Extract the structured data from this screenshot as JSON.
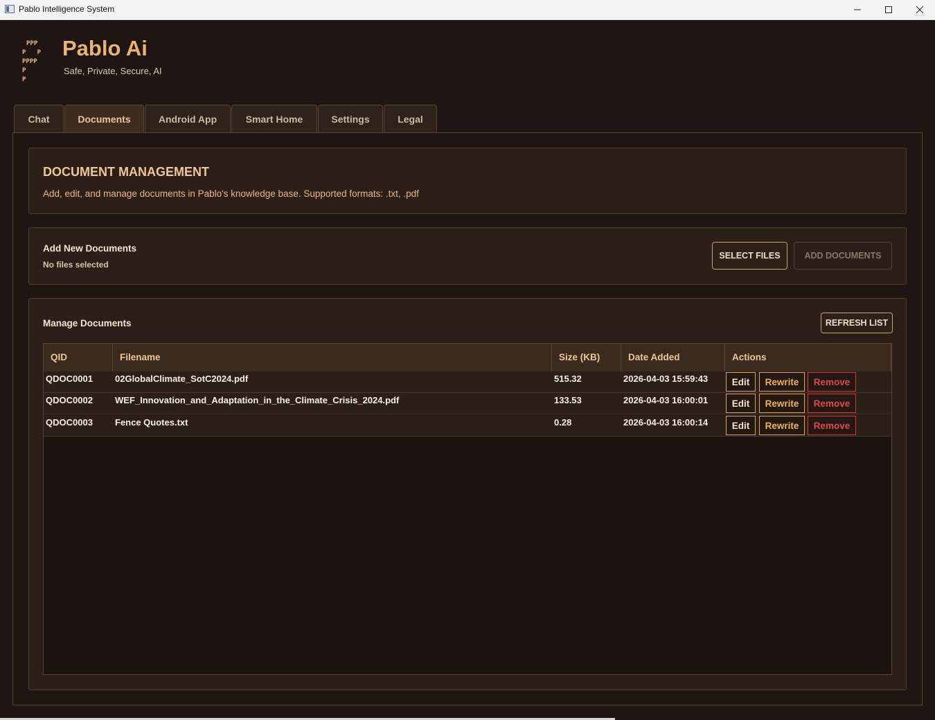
{
  "window": {
    "title": "Pablo Intelligence System"
  },
  "header": {
    "logo_lines": [
      "PPP",
      "P   P",
      "PPPP",
      "P",
      "P"
    ],
    "title": "Pablo Ai",
    "subtitle": "Safe, Private, Secure, AI"
  },
  "tabs": [
    {
      "label": "Chat",
      "active": false
    },
    {
      "label": "Documents",
      "active": true
    },
    {
      "label": "Android App",
      "active": false
    },
    {
      "label": "Smart Home",
      "active": false
    },
    {
      "label": "Settings",
      "active": false
    },
    {
      "label": "Legal",
      "active": false
    }
  ],
  "doc_header": {
    "title": "DOCUMENT MANAGEMENT",
    "description": "Add, edit, and manage documents in Pablo's knowledge base. Supported formats: .txt, .pdf"
  },
  "add_panel": {
    "title": "Add New Documents",
    "status": "No files selected",
    "select_label": "SELECT FILES",
    "add_label": "ADD DOCUMENTS"
  },
  "manage_panel": {
    "title": "Manage Documents",
    "refresh_label": "REFRESH LIST",
    "columns": [
      "QID",
      "Filename",
      "Size (KB)",
      "Date Added",
      "Actions"
    ],
    "rows": [
      {
        "qid": "QDOC0001",
        "filename": "02GlobalClimate_SotC2024.pdf",
        "size": "515.32",
        "date": "2026-04-03 15:59:43"
      },
      {
        "qid": "QDOC0002",
        "filename": "WEF_Innovation_and_Adaptation_in_the_Climate_Crisis_2024.pdf",
        "size": "133.53",
        "date": "2026-04-03 16:00:01"
      },
      {
        "qid": "QDOC0003",
        "filename": "Fence Quotes.txt",
        "size": "0.28",
        "date": "2026-04-03 16:00:14"
      }
    ],
    "actions": {
      "edit": "Edit",
      "rewrite": "Rewrite",
      "remove": "Remove"
    }
  },
  "colors": {
    "accent": "#e8b27c",
    "background": "#1f1511",
    "panel": "#2b1f18",
    "danger": "#d5363a"
  }
}
